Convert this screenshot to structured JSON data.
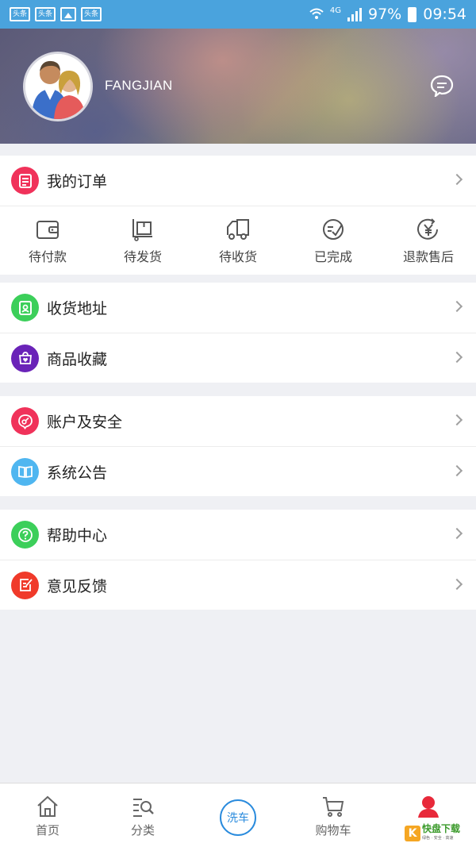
{
  "status_bar": {
    "badges": [
      "头条",
      "头条",
      "头条"
    ],
    "network": "4G",
    "battery": "97%",
    "time": "09:54"
  },
  "profile": {
    "username": "FANGJIAN"
  },
  "orders": {
    "label": "我的订单",
    "icon_color": "#f0325a",
    "statuses": [
      {
        "label": "待付款",
        "icon": "wallet-icon"
      },
      {
        "label": "待发货",
        "icon": "package-icon"
      },
      {
        "label": "待收货",
        "icon": "truck-icon"
      },
      {
        "label": "已完成",
        "icon": "done-icon"
      },
      {
        "label": "退款售后",
        "icon": "refund-icon"
      }
    ]
  },
  "menu_groups": [
    [
      {
        "label": "收货地址",
        "icon": "address-icon",
        "color": "#3ccf5a"
      },
      {
        "label": "商品收藏",
        "icon": "favorite-icon",
        "color": "#6a23b8"
      }
    ],
    [
      {
        "label": "账户及安全",
        "icon": "security-icon",
        "color": "#f0325a"
      },
      {
        "label": "系统公告",
        "icon": "notice-icon",
        "color": "#4fb6f0"
      }
    ],
    [
      {
        "label": "帮助中心",
        "icon": "help-icon",
        "color": "#3ccf5a"
      },
      {
        "label": "意见反馈",
        "icon": "feedback-icon",
        "color": "#f03a2a"
      }
    ]
  ],
  "bottom_nav": [
    {
      "label": "首页",
      "icon": "home-icon"
    },
    {
      "label": "分类",
      "icon": "category-search-icon"
    },
    {
      "label": "洗车",
      "icon": "wash-icon"
    },
    {
      "label": "购物车",
      "icon": "cart-icon"
    },
    {
      "label": "",
      "icon": "profile-icon",
      "active_color": "#e8293a"
    }
  ],
  "watermark": {
    "logo": "K",
    "text": "快盘下载",
    "sub": "绿色 · 安全 · 高速"
  }
}
